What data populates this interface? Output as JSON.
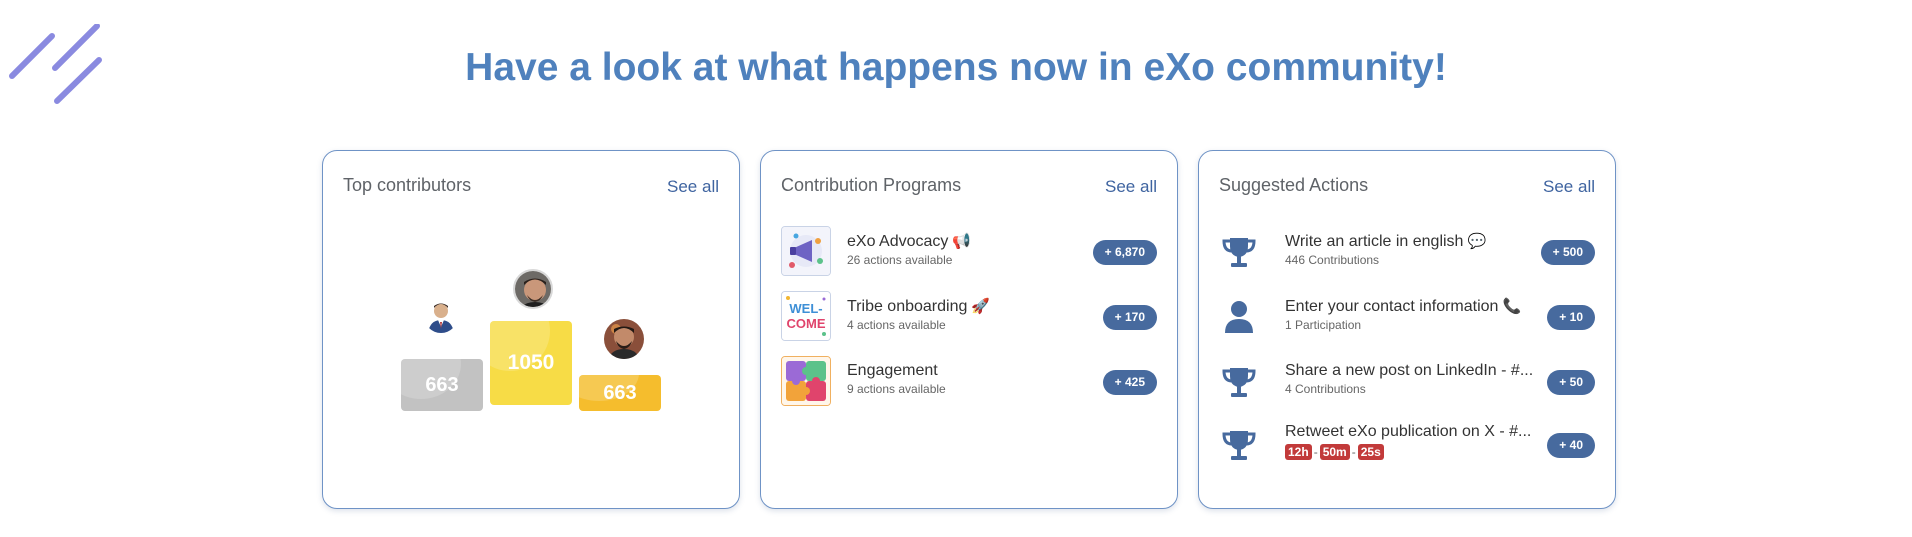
{
  "headline": "Have a look at what happens now in eXo community!",
  "colors": {
    "accent": "#4f81bd",
    "pill": "#476a9e",
    "timer": "#c23a3a",
    "gold": "#f7dc46",
    "silver": "#c2c2c2",
    "bronze": "#f5bd2d"
  },
  "top_contributors": {
    "title": "Top contributors",
    "see_all": "See all",
    "podium": [
      {
        "rank": "second",
        "score": "663"
      },
      {
        "rank": "first",
        "score": "1050"
      },
      {
        "rank": "third",
        "score": "663"
      }
    ]
  },
  "programs": {
    "title": "Contribution Programs",
    "see_all": "See all",
    "items": [
      {
        "name": "eXo Advocacy",
        "emoji": "📢",
        "sub": "26 actions available",
        "points": "+ 6,870",
        "icon": "megaphone-thumbnail"
      },
      {
        "name": "Tribe onboarding",
        "emoji": "🚀",
        "sub": "4 actions available",
        "points": "+ 170",
        "icon": "welcome-thumbnail"
      },
      {
        "name": "Engagement",
        "emoji": "",
        "sub": "9 actions available",
        "points": "+ 425",
        "icon": "puzzle-thumbnail"
      }
    ]
  },
  "actions": {
    "title": "Suggested Actions",
    "see_all": "See all",
    "items": [
      {
        "name": "Write an article in english",
        "emoji": "💬",
        "sub": "446 Contributions",
        "points": "+ 500",
        "icon": "trophy-icon"
      },
      {
        "name": "Enter your contact information",
        "emoji": "📞",
        "sub": "1 Participation",
        "points": "+ 10",
        "icon": "user-icon"
      },
      {
        "name": "Share a new post on LinkedIn - #...",
        "emoji": "",
        "sub": "4 Contributions",
        "points": "+ 50",
        "icon": "trophy-icon"
      },
      {
        "name": "Retweet eXo publication on X - #...",
        "emoji": "",
        "timer": [
          "12h",
          "50m",
          "25s"
        ],
        "timer_sep": "-",
        "points": "+ 40",
        "icon": "trophy-icon"
      }
    ]
  }
}
